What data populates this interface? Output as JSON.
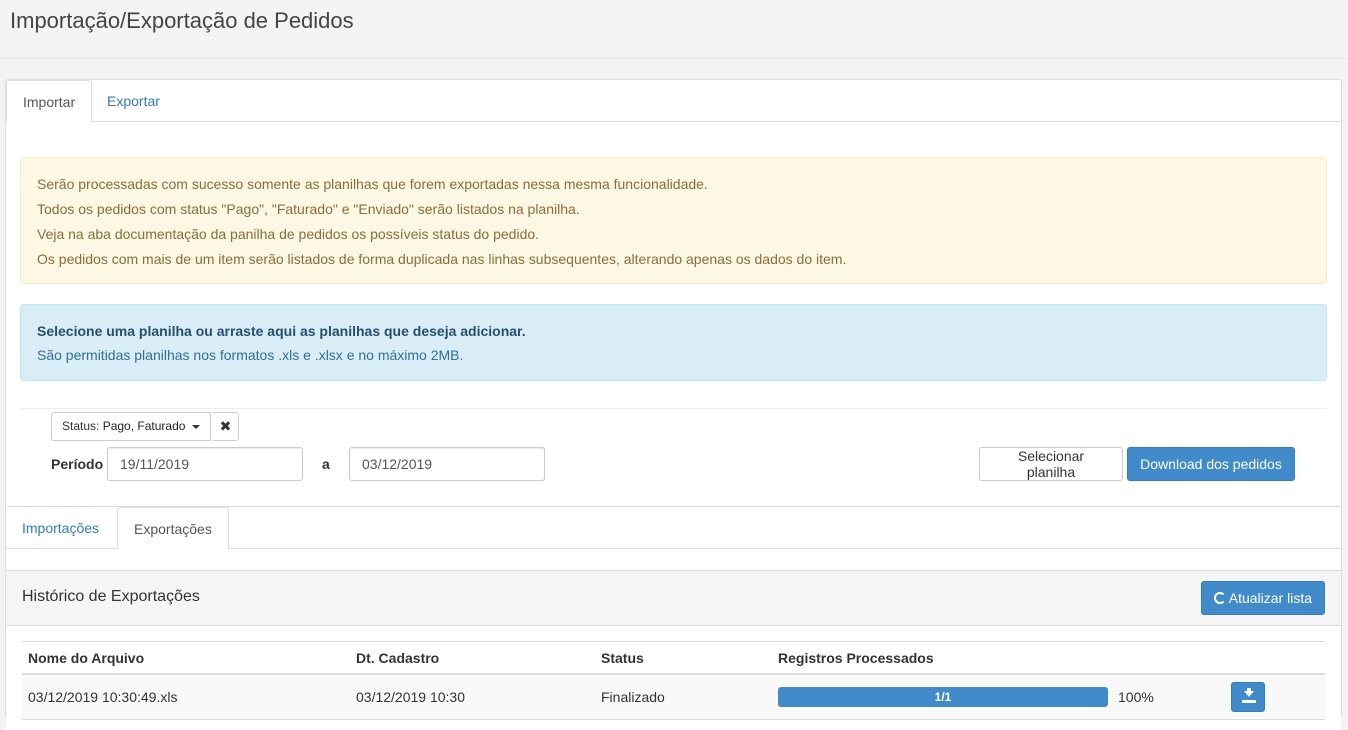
{
  "page": {
    "title": "Importação/Exportação de Pedidos"
  },
  "tabs": [
    {
      "label": "Importar",
      "active": true
    },
    {
      "label": "Exportar",
      "active": false
    }
  ],
  "warning": {
    "lines": [
      "Serão processadas com sucesso somente as planilhas que forem exportadas nessa mesma funcionalidade.",
      "Todos os pedidos com status \"Pago\", \"Faturado\" e \"Enviado\" serão listados na planilha.",
      "Veja na aba documentação da panilha de pedidos os possíveis status do pedido.",
      "Os pedidos com mais de um item serão listados de forma duplicada nas linhas subsequentes, alterando apenas os dados do item."
    ]
  },
  "info": {
    "title": "Selecione uma planilha ou arraste aqui as planilhas que deseja adicionar.",
    "note": "São permitidas planilhas nos formatos .xls e .xlsx e no máximo 2MB."
  },
  "filters": {
    "status_label": "Status:",
    "status_value": "Pago, Faturado",
    "clear_glyph": "✖",
    "periodo_label": "Período",
    "date_from": "19/11/2019",
    "separator": "a",
    "date_to": "03/12/2019"
  },
  "actions": {
    "select_label": "Selecionar planilha",
    "download_label": "Download dos pedidos"
  },
  "inner_tabs": [
    {
      "label": "Importações",
      "active": false
    },
    {
      "label": "Exportações",
      "active": true
    }
  ],
  "history": {
    "title": "Histórico de Exportações",
    "refresh_label": "Atualizar lista",
    "columns": [
      "Nome do Arquivo",
      "Dt. Cadastro",
      "Status",
      "Registros Processados"
    ],
    "rows": [
      {
        "file": "03/12/2019 10:30:49.xls",
        "date": "03/12/2019 10:30",
        "status": "Finalizado",
        "progress_label": "1/1",
        "progress_fraction": 1.0,
        "percent": "100%"
      }
    ]
  },
  "colors": {
    "primary": "#428bca",
    "warning_bg": "#fcf8e3",
    "info_bg": "#d9edf7"
  }
}
